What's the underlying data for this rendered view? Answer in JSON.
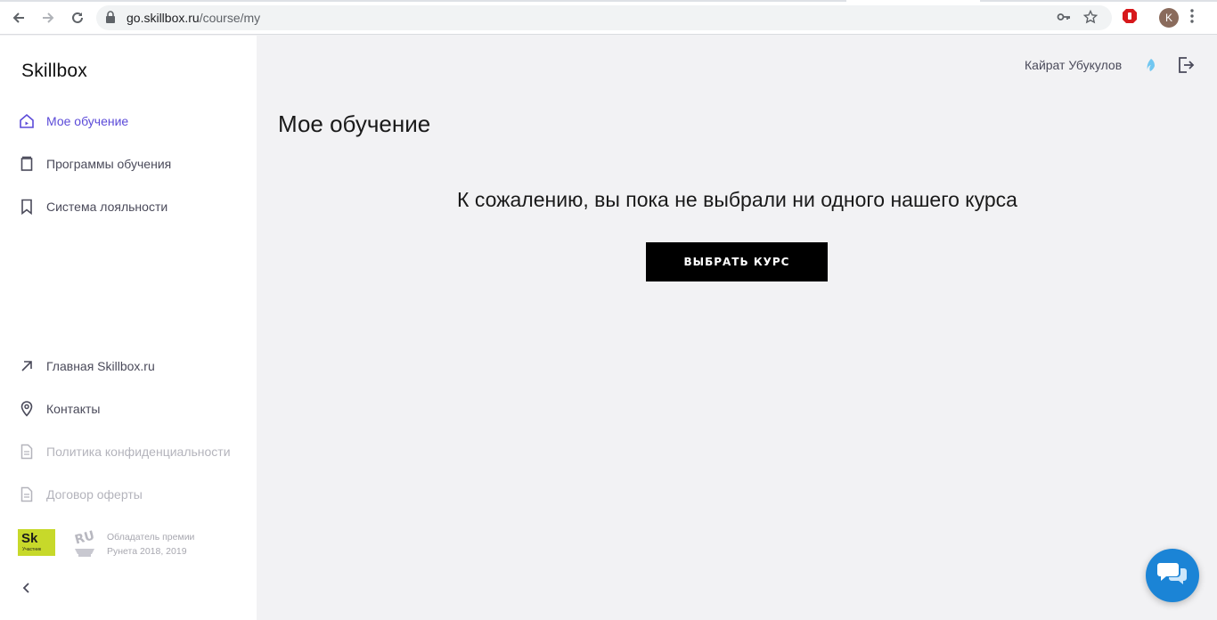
{
  "browser": {
    "url_host": "go.skillbox.ru",
    "url_path": "/course/my",
    "avatar_letter": "K"
  },
  "sidebar": {
    "logo": "Skillbox",
    "items": [
      {
        "label": "Мое обучение",
        "icon": "home-icon",
        "active": true
      },
      {
        "label": "Программы обучения",
        "icon": "book-icon"
      },
      {
        "label": "Система лояльности",
        "icon": "bookmark-icon"
      }
    ],
    "footer_items": [
      {
        "label": "Главная Skillbox.ru",
        "icon": "arrow-up-right-icon"
      },
      {
        "label": "Контакты",
        "icon": "map-pin-icon"
      },
      {
        "label": "Политика конфиденциальности",
        "icon": "document-icon",
        "muted": true
      },
      {
        "label": "Договор оферты",
        "icon": "document-icon",
        "muted": true
      }
    ],
    "sk_badge_text": "Sk",
    "sk_badge_sub": "Участник",
    "award_line1": "Обладатель премии",
    "award_line2": "Рунета 2018, 2019"
  },
  "header": {
    "user_name": "Кайрат Убукулов"
  },
  "main": {
    "title": "Мое обучение",
    "empty_message": "К сожалению, вы пока не выбрали ни одного нашего курса",
    "choose_button": "ВЫБРАТЬ КУРС"
  },
  "colors": {
    "accent": "#5b4ad8",
    "background": "#f2f2f4",
    "chat": "#1b84d6",
    "sk_badge": "#c7d92a"
  }
}
